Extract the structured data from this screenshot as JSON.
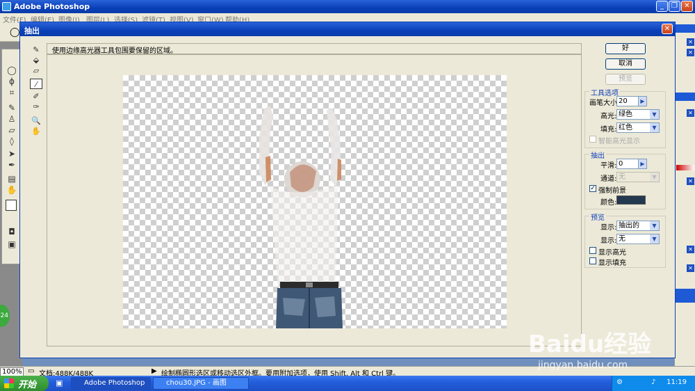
{
  "app": {
    "title": "Adobe Photoshop",
    "menus": [
      "文件(F)",
      "编辑(E)",
      "图像(I)",
      "图层(L)",
      "选择(S)",
      "滤镜(T)",
      "视图(V)",
      "窗口(W)",
      "帮助(H)"
    ]
  },
  "dialog": {
    "title": "抽出",
    "hint": "使用边缘高光器工具包围要保留的区域。",
    "buttons": {
      "ok": "好",
      "cancel": "取消",
      "preview": "预览"
    },
    "tool_options": {
      "title": "工具选项",
      "brush_size_label": "画笔大小:",
      "brush_size_value": "20",
      "highlight_label": "高光:",
      "highlight_value": "绿色",
      "fill_label": "填充:",
      "fill_value": "红色",
      "smart_highlight_label": "智能高光显示"
    },
    "extraction": {
      "title": "抽出",
      "smooth_label": "平滑:",
      "smooth_value": "0",
      "channel_label": "通道:",
      "channel_value": "无",
      "force_foreground_label": "强制前景",
      "force_foreground_checked": true,
      "color_label": "颜色:",
      "color_value": "#23394e"
    },
    "preview_group": {
      "title": "预览",
      "show_label_1": "显示:",
      "show_value_1": "抽出的",
      "show_label_2": "显示:",
      "show_value_2": "无",
      "show_highlight_label": "显示高光",
      "show_fill_label": "显示填充"
    }
  },
  "status_bar": {
    "zoom": "100%",
    "doc_info": "文档:488K/488K",
    "message": "绘制椭圆形选区或移动选区外框。要用附加选项，使用 Shift, Alt 和 Ctrl 键。"
  },
  "taskbar": {
    "start_label": "开始",
    "tasks": [
      "Adobe Photoshop",
      "chou30.JPG - 画图"
    ],
    "clock": "11:19"
  },
  "overlays": {
    "badge": "24",
    "watermark_brand": "Baidu经验",
    "watermark_url": "jingyan.baidu.com"
  }
}
